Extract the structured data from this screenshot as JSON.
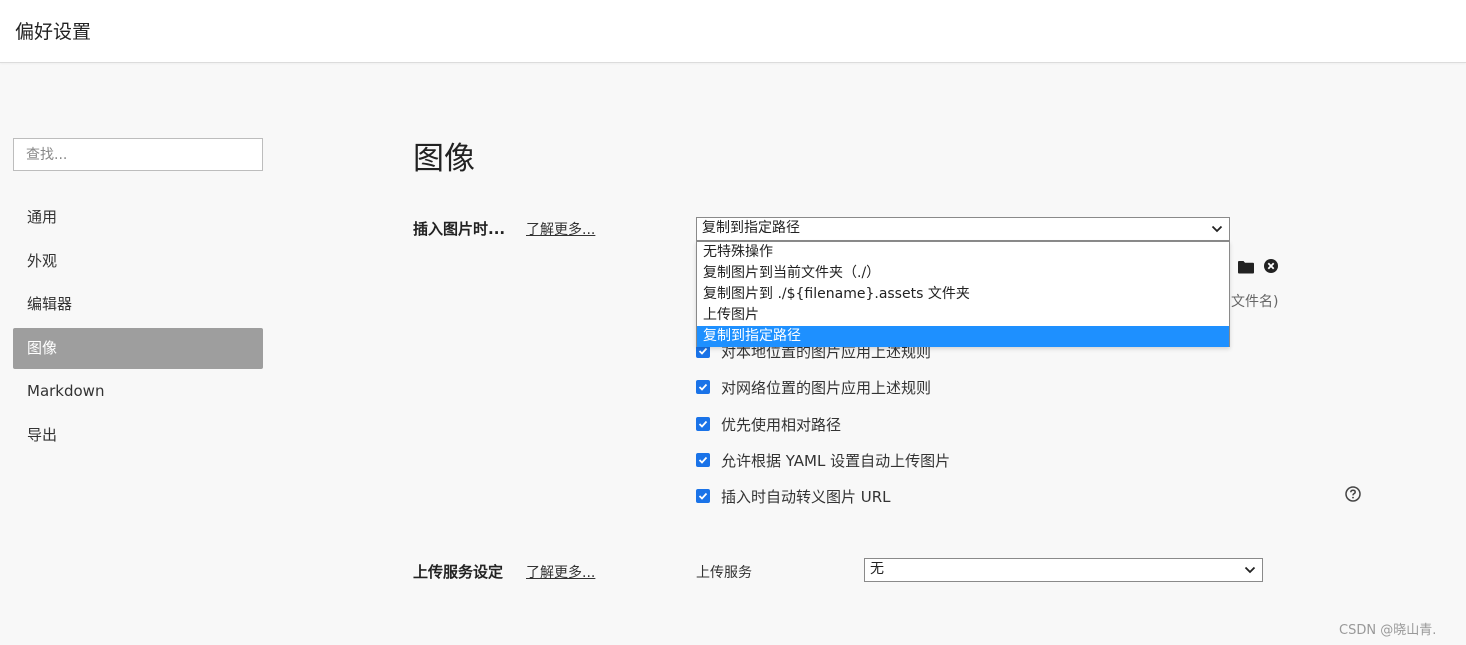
{
  "window": {
    "title": "偏好设置"
  },
  "sidebar": {
    "search_placeholder": "查找...",
    "items": [
      {
        "label": "通用",
        "active": false
      },
      {
        "label": "外观",
        "active": false
      },
      {
        "label": "编辑器",
        "active": false
      },
      {
        "label": "图像",
        "active": true
      },
      {
        "label": "Markdown",
        "active": false
      },
      {
        "label": "导出",
        "active": false
      }
    ]
  },
  "main": {
    "title": "图像",
    "insert": {
      "label": "插入图片时...",
      "learn_more": "了解更多...",
      "selected": "复制到指定路径",
      "options": [
        "无特殊操作",
        "复制图片到当前文件夹（./）",
        "复制图片到 ./${filename}.assets 文件夹",
        "上传图片",
        "复制到指定路径"
      ],
      "selected_index": 4,
      "partial_hint": "文件名)"
    },
    "checkboxes": [
      {
        "label": "对本地位置的图片应用上述规则",
        "checked": true
      },
      {
        "label": "对网络位置的图片应用上述规则",
        "checked": true
      },
      {
        "label": "优先使用相对路径",
        "checked": true
      },
      {
        "label": "允许根据 YAML 设置自动上传图片",
        "checked": true
      },
      {
        "label": "插入时自动转义图片 URL",
        "checked": true
      }
    ],
    "upload": {
      "label": "上传服务设定",
      "learn_more": "了解更多...",
      "service_label": "上传服务",
      "service_value": "无"
    }
  },
  "watermark": "CSDN @晓山青.",
  "colors": {
    "accent": "#1e90ff",
    "active_nav": "#9e9e9e",
    "checkbox": "#1a73e8"
  }
}
